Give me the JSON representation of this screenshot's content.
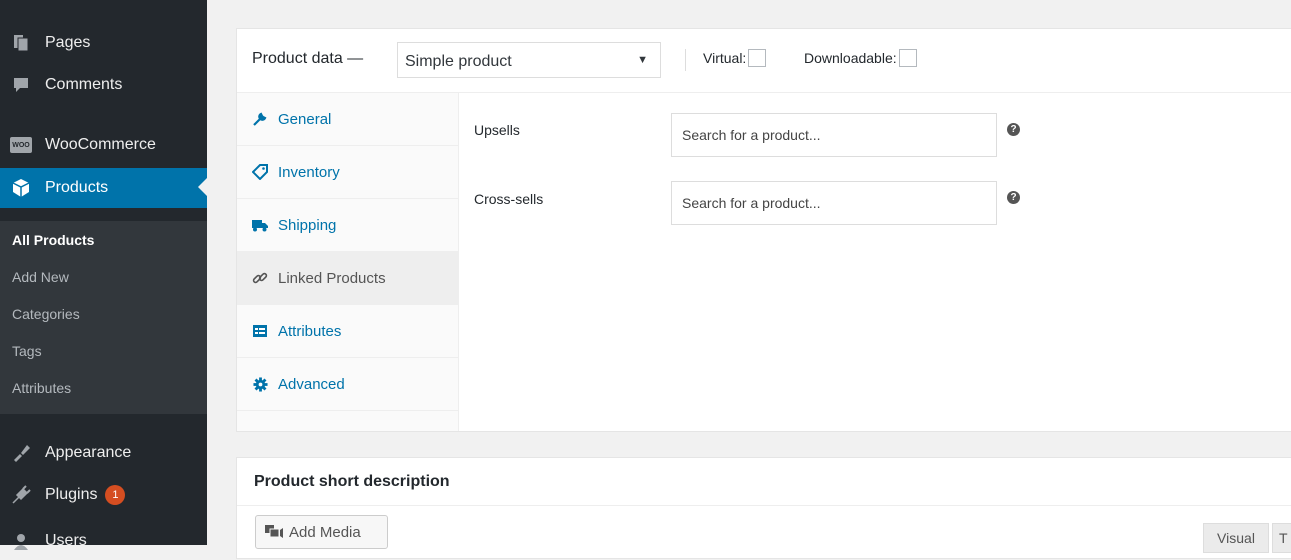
{
  "sidebar": {
    "items": [
      {
        "label": "Pages",
        "icon": "pages-icon"
      },
      {
        "label": "Comments",
        "icon": "comments-icon"
      },
      {
        "label": "WooCommerce",
        "icon": "woocommerce-icon",
        "logo_text": "WOO"
      },
      {
        "label": "Products",
        "icon": "products-icon"
      },
      {
        "label": "Appearance",
        "icon": "appearance-icon"
      },
      {
        "label": "Plugins",
        "icon": "plugins-icon",
        "badge": "1"
      },
      {
        "label": "Users",
        "icon": "users-icon"
      }
    ],
    "submenu": [
      "All Products",
      "Add New",
      "Categories",
      "Tags",
      "Attributes"
    ],
    "accent_color": "#0073aa"
  },
  "product_data": {
    "title": "Product data —",
    "type_selected": "Simple product",
    "virtual_label": "Virtual:",
    "downloadable_label": "Downloadable:",
    "tabs": [
      {
        "label": "General",
        "icon": "wrench-icon"
      },
      {
        "label": "Inventory",
        "icon": "tag-icon"
      },
      {
        "label": "Shipping",
        "icon": "truck-icon"
      },
      {
        "label": "Linked Products",
        "icon": "link-icon"
      },
      {
        "label": "Attributes",
        "icon": "list-icon"
      },
      {
        "label": "Advanced",
        "icon": "gear-icon"
      }
    ],
    "active_tab": "Linked Products",
    "fields": [
      {
        "label": "Upsells",
        "placeholder": "Search for a product..."
      },
      {
        "label": "Cross-sells",
        "placeholder": "Search for a product..."
      }
    ],
    "help_glyph": "?"
  },
  "short_description": {
    "title": "Product short description",
    "add_media_label": "Add Media",
    "editor_tabs": [
      "Visual",
      "T"
    ]
  }
}
